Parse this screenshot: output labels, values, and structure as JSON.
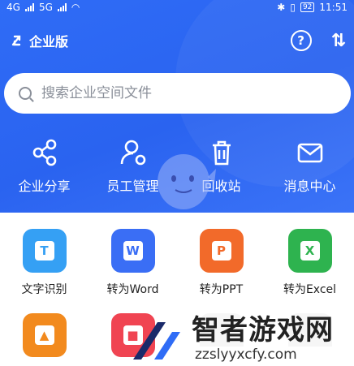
{
  "statusbar": {
    "network_left": "4G",
    "network_right": "5G",
    "battery": "92",
    "time": "11:51"
  },
  "topbar": {
    "brand": "企业版",
    "icons": [
      "logo-icon",
      "help-icon",
      "sort-icon"
    ]
  },
  "search": {
    "placeholder": "搜索企业空间文件"
  },
  "quick_actions": [
    {
      "label": "企业分享",
      "icon": "share-icon"
    },
    {
      "label": "员工管理",
      "icon": "employee-manage-icon"
    },
    {
      "label": "回收站",
      "icon": "trash-icon"
    },
    {
      "label": "消息中心",
      "icon": "mail-icon"
    }
  ],
  "tools_row1": [
    {
      "label": "文字识别",
      "badge": "T",
      "color": "#35a0f4"
    },
    {
      "label": "转为Word",
      "badge": "W",
      "color": "#3a6ef5"
    },
    {
      "label": "转为PPT",
      "badge": "P",
      "color": "#f26a2a"
    },
    {
      "label": "转为Excel",
      "badge": "X",
      "color": "#2eb34f"
    }
  ],
  "tools_row2": [
    {
      "badge": "▲",
      "color": "#f28a1e"
    },
    {
      "badge": "■",
      "color": "#f04452"
    },
    {
      "badge": "",
      "color": "#f6f6f6"
    },
    {
      "badge": "",
      "color": "#f6f6f6"
    }
  ],
  "watermark": {
    "title": "智者游戏网",
    "url": "zzslyyxcfy.com"
  },
  "colors": {
    "header_blue": "#2f6cf6",
    "accent": "#3a6ef5"
  }
}
